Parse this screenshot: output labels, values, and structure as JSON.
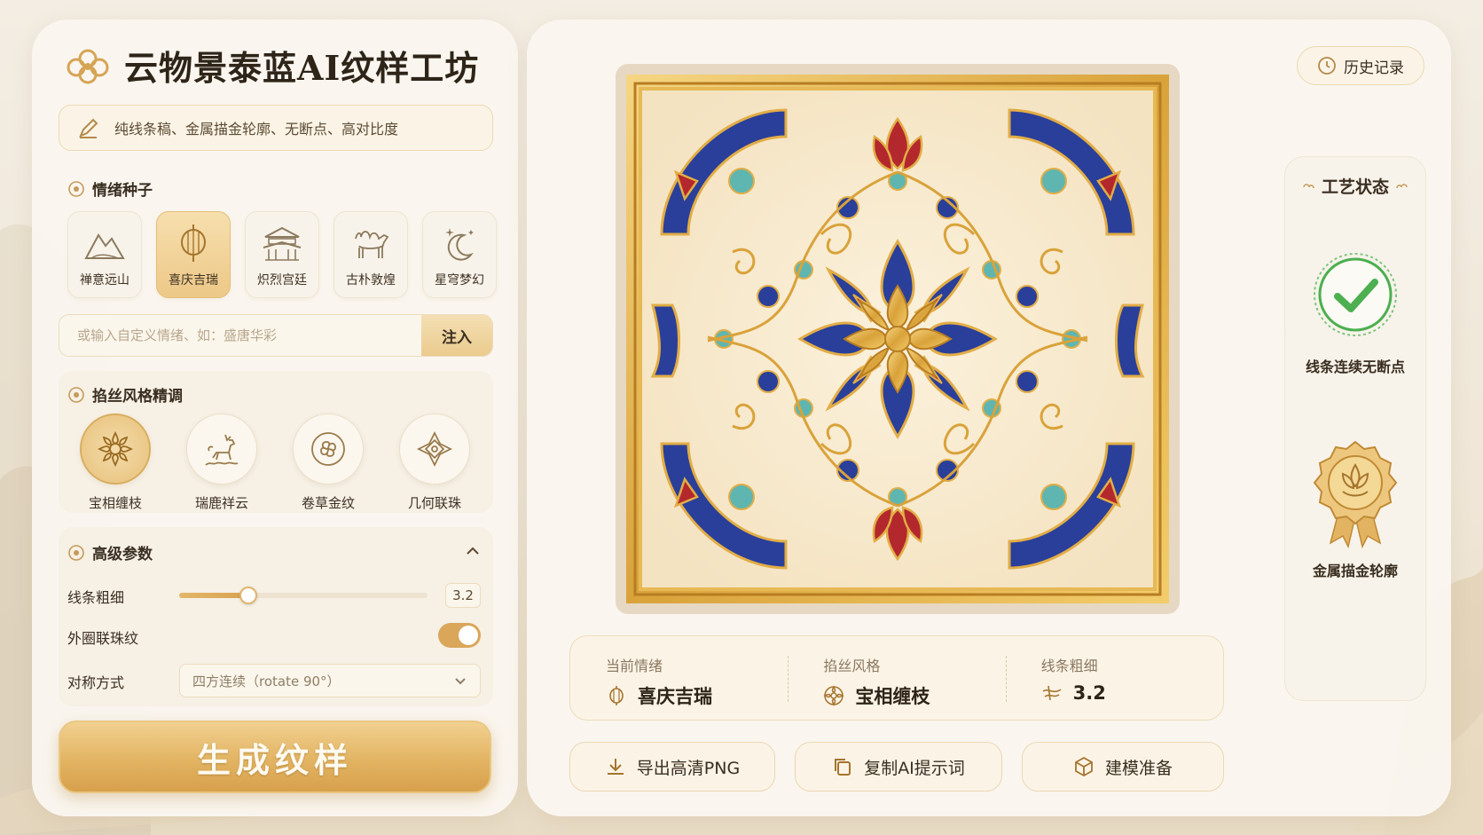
{
  "app": {
    "title": "云物景泰蓝AI纹样工坊"
  },
  "prompt_box": {
    "text": "纯线条稿、金属描金轮廓、无断点、高对比度"
  },
  "mood": {
    "label": "情绪种子",
    "items": [
      {
        "label": "禅意远山",
        "icon": "mountain-icon",
        "active": false
      },
      {
        "label": "喜庆吉瑞",
        "icon": "lantern-icon",
        "active": true
      },
      {
        "label": "炽烈宫廷",
        "icon": "palace-icon",
        "active": false
      },
      {
        "label": "古朴敦煌",
        "icon": "camel-icon",
        "active": false
      },
      {
        "label": "星穹梦幻",
        "icon": "moon-star-icon",
        "active": false
      }
    ],
    "custom_placeholder": "或输入自定义情绪、如：盛唐华彩",
    "inject_label": "注入"
  },
  "filigree": {
    "label": "掐丝风格精调",
    "items": [
      {
        "label": "宝相缠枝",
        "icon": "lotus-scroll-icon",
        "active": true
      },
      {
        "label": "瑞鹿祥云",
        "icon": "deer-cloud-icon",
        "active": false
      },
      {
        "label": "卷草金纹",
        "icon": "scroll-grass-icon",
        "active": false
      },
      {
        "label": "几何联珠",
        "icon": "geometric-bead-icon",
        "active": false
      }
    ]
  },
  "advanced": {
    "label": "高级参数",
    "line_width_label": "线条粗细",
    "line_width_value": "3.2",
    "line_width_fraction": 0.28,
    "outer_ring_label": "外圈联珠纹",
    "outer_ring_on": true,
    "symmetry_label": "对称方式",
    "symmetry_value": "四方连续（rotate 90°）"
  },
  "generate_label": "生成纹样",
  "history_label": "历史记录",
  "info": {
    "mood_key": "当前情绪",
    "mood_value": "喜庆吉瑞",
    "style_key": "掐丝风格",
    "style_value": "宝相缠枝",
    "width_key": "线条粗细",
    "width_value": "3.2"
  },
  "actions": {
    "export": "导出高清PNG",
    "copy_prompt": "复制AI提示词",
    "modeling": "建模准备"
  },
  "status": {
    "title": "工艺状态",
    "check_label": "线条连续无断点",
    "badge_label": "金属描金轮廓"
  },
  "colors": {
    "gold": "#d9a24f",
    "cloisonne_blue": "#2a3f9a",
    "cloisonne_red": "#b3282d",
    "turquoise": "#5fb6b0",
    "check_green": "#4caf50"
  }
}
